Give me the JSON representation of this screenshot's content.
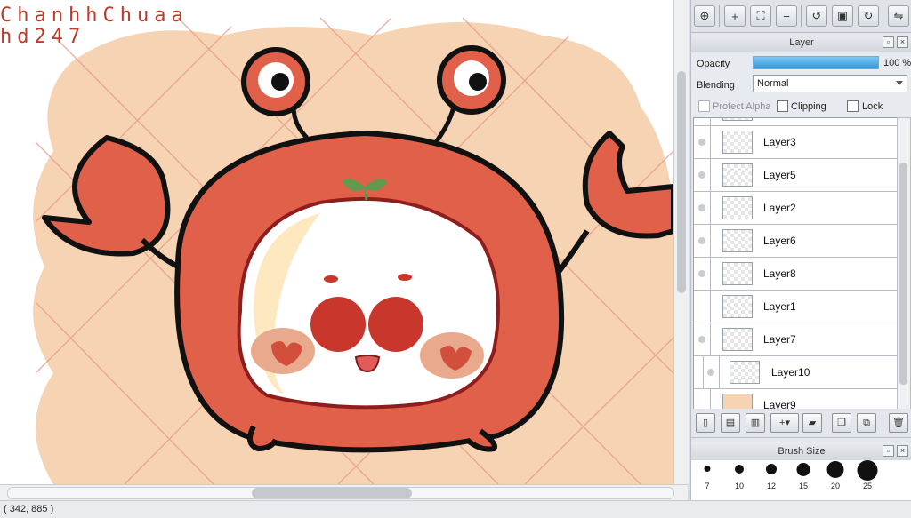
{
  "canvas": {
    "watermark_line1": "ChanhhChuaa",
    "watermark_line2": "hd247"
  },
  "status": {
    "coords": "( 342, 885 )"
  },
  "toolbar": {
    "icons": [
      "zoom-actual-icon",
      "zoom-in-icon",
      "fit-window-icon",
      "zoom-out-icon",
      "rotate-left-icon",
      "reset-rotation-icon",
      "rotate-right-icon",
      "flip-icon"
    ]
  },
  "layer_panel": {
    "title": "Layer",
    "opacity_label": "Opacity",
    "opacity_value": "100 %",
    "opacity_fraction": 1.0,
    "blending_label": "Blending",
    "blending_value": "Normal",
    "protect_alpha_label": "Protect Alpha",
    "clipping_label": "Clipping",
    "lock_label": "Lock",
    "layers": [
      {
        "name": "Layer3"
      },
      {
        "name": "Layer5"
      },
      {
        "name": "Layer2"
      },
      {
        "name": "Layer6"
      },
      {
        "name": "Layer8"
      },
      {
        "name": "Layer1"
      },
      {
        "name": "Layer7"
      },
      {
        "name": "Layer10"
      },
      {
        "name": "Layer9"
      }
    ]
  },
  "brush_panel": {
    "title": "Brush Size",
    "sizes": [
      "7",
      "10",
      "12",
      "15",
      "20",
      "25"
    ]
  },
  "colors": {
    "accent": "#2f97dc",
    "crab_red": "#e0604a",
    "background_peach": "#f5d3b3"
  }
}
